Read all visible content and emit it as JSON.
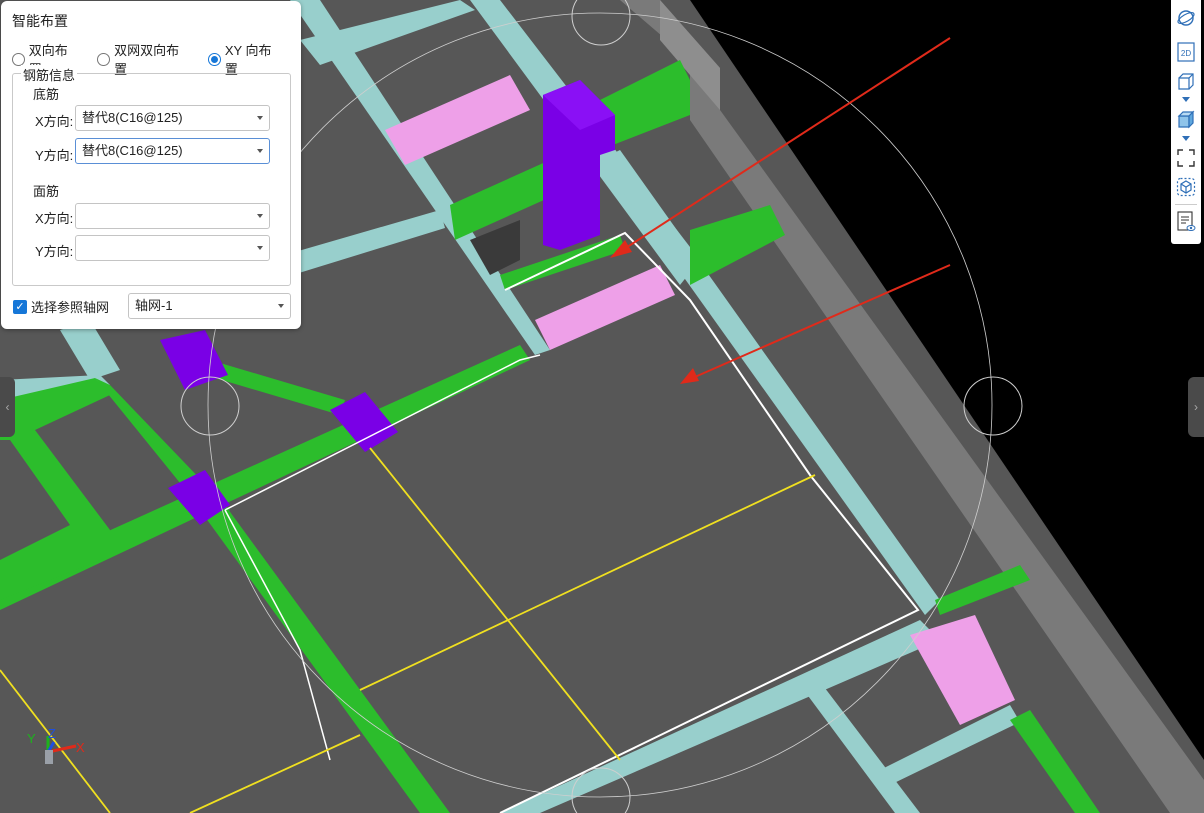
{
  "panel": {
    "title": "智能布置",
    "layout_options": [
      {
        "label": "双向布置",
        "selected": false
      },
      {
        "label": "双网双向布置",
        "selected": false
      },
      {
        "label": "XY 向布置",
        "selected": true
      }
    ],
    "rebar_info_label": "钢筋信息",
    "bottom": {
      "title": "底筋",
      "x_label": "X方向:",
      "x_value": "替代8(C16@125)",
      "y_label": "Y方向:",
      "y_value": "替代8(C16@125)"
    },
    "top": {
      "title": "面筋",
      "x_label": "X方向:",
      "x_value": "",
      "y_label": "Y方向:",
      "y_value": ""
    },
    "ref_axis_checkbox": {
      "label": "选择参照轴网",
      "checked": true,
      "check_glyph": "✓"
    },
    "axis_grid_value": "轴网-1"
  },
  "toolbar": {
    "items": [
      {
        "icon": "orbit-icon"
      },
      {
        "icon": "view-2d-icon",
        "text": "2D"
      },
      {
        "icon": "wireframe-cube-icon"
      },
      {
        "icon": "solid-cube-icon"
      },
      {
        "icon": "fit-view-icon"
      },
      {
        "icon": "section-box-icon"
      },
      {
        "icon": "properties-view-icon"
      }
    ]
  },
  "side_handles": {
    "left": "‹",
    "right": "›"
  },
  "gizmo": {
    "x": "X",
    "y": "Y",
    "z": "Z"
  },
  "colors": {
    "slab": "#575757",
    "beam_cyan": "#98cfcc",
    "beam_green": "#2cbd2c",
    "column_purple": "#7a00e6",
    "highlight_pink": "#eea0e8",
    "grid_yellow": "#f0e020",
    "arrow_red": "#e02a1a",
    "accent_blue": "#1677d8"
  }
}
